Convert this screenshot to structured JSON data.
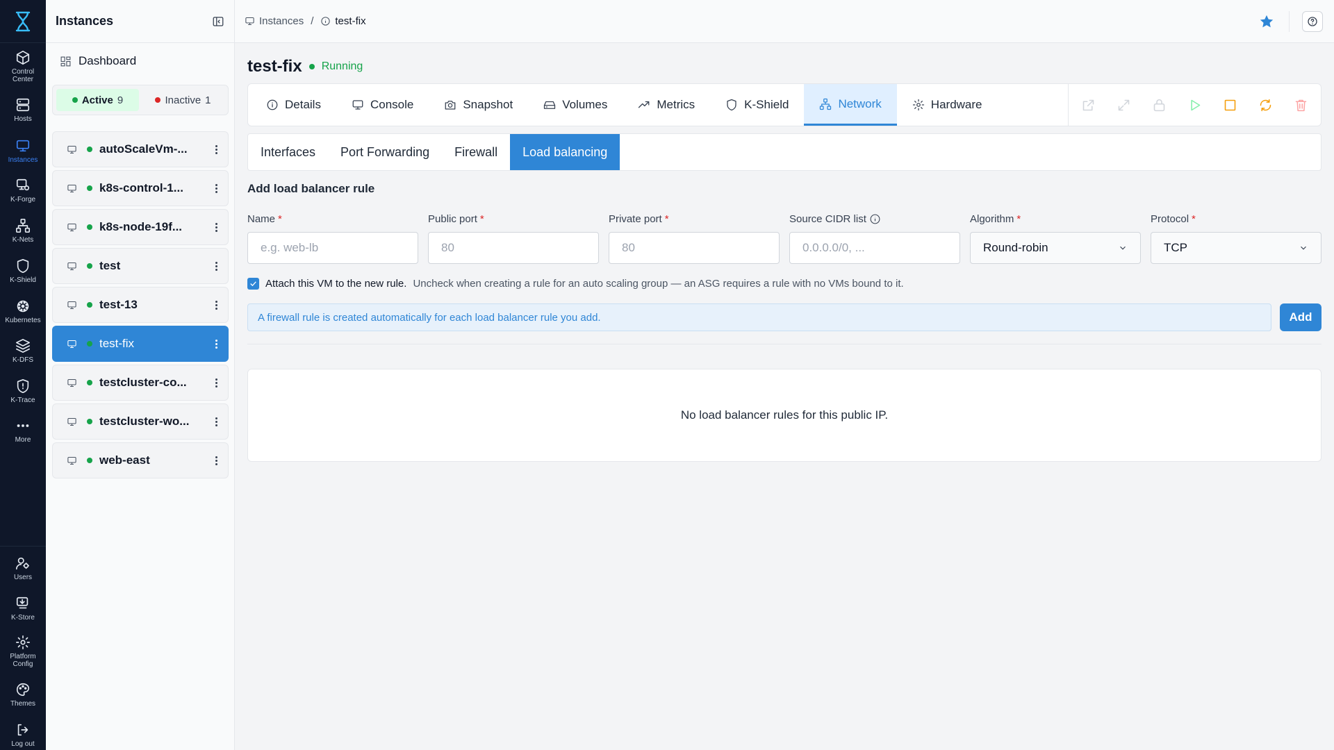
{
  "rail": {
    "items": [
      {
        "label1": "Control",
        "label2": "Center",
        "icon": "cube-icon"
      },
      {
        "label1": "Hosts",
        "label2": "",
        "icon": "server-icon"
      },
      {
        "label1": "Instances",
        "label2": "",
        "icon": "monitor-icon"
      },
      {
        "label1": "K-Forge",
        "label2": "",
        "icon": "forge-icon"
      },
      {
        "label1": "K-Nets",
        "label2": "",
        "icon": "network-icon"
      },
      {
        "label1": "K-Shield",
        "label2": "",
        "icon": "shield-icon"
      },
      {
        "label1": "Kubernetes",
        "label2": "",
        "icon": "helm-icon"
      },
      {
        "label1": "K-DFS",
        "label2": "",
        "icon": "layers-icon"
      },
      {
        "label1": "K-Trace",
        "label2": "",
        "icon": "trace-icon"
      },
      {
        "label1": "More",
        "label2": "",
        "icon": "more-icon"
      },
      {
        "label1": "Users",
        "label2": "",
        "icon": "users-icon"
      },
      {
        "label1": "K-Store",
        "label2": "",
        "icon": "store-icon"
      },
      {
        "label1": "Platform",
        "label2": "Config",
        "icon": "gear-icon"
      },
      {
        "label1": "Themes",
        "label2": "",
        "icon": "palette-icon"
      },
      {
        "label1": "Log out",
        "label2": "",
        "icon": "logout-icon"
      }
    ],
    "active_color": "#3b82f6"
  },
  "sidebar": {
    "title": "Instances",
    "dashboard": "Dashboard",
    "filter": {
      "active_label": "Active",
      "active_count": "9",
      "inactive_label": "Inactive",
      "inactive_count": "1"
    },
    "vms": [
      {
        "name": "autoScaleVm-..."
      },
      {
        "name": "k8s-control-1..."
      },
      {
        "name": "k8s-node-19f..."
      },
      {
        "name": "test"
      },
      {
        "name": "test-13"
      },
      {
        "name": "test-fix"
      },
      {
        "name": "testcluster-co..."
      },
      {
        "name": "testcluster-wo..."
      },
      {
        "name": "web-east"
      }
    ]
  },
  "topbar": {
    "crumb_root": "Instances",
    "crumb_sep": "/",
    "crumb_current": "test-fix"
  },
  "main": {
    "title": "test-fix",
    "status": "Running",
    "status_color": "#16a34a",
    "tabs": [
      {
        "label": "Details",
        "icon": "info-icon"
      },
      {
        "label": "Console",
        "icon": "monitor-icon"
      },
      {
        "label": "Snapshot",
        "icon": "camera-icon"
      },
      {
        "label": "Volumes",
        "icon": "disk-icon"
      },
      {
        "label": "Metrics",
        "icon": "trend-icon"
      },
      {
        "label": "K-Shield",
        "icon": "shield-icon"
      },
      {
        "label": "Network",
        "icon": "network-icon"
      },
      {
        "label": "Hardware",
        "icon": "gear-icon"
      }
    ],
    "subtabs": [
      "Interfaces",
      "Port Forwarding",
      "Firewall",
      "Load balancing"
    ],
    "section_title": "Add load balancer rule",
    "form": {
      "name_label": "Name",
      "name_placeholder": "e.g. web-lb",
      "public_label": "Public port",
      "public_placeholder": "80",
      "private_label": "Private port",
      "private_placeholder": "80",
      "cidr_label": "Source CIDR list",
      "cidr_placeholder": "0.0.0.0/0, ...",
      "algo_label": "Algorithm",
      "algo_value": "Round-robin",
      "proto_label": "Protocol",
      "proto_value": "TCP",
      "required_mark": "*"
    },
    "attach_strong": "Attach this VM to the new rule.",
    "attach_note": "Uncheck when creating a rule for an auto scaling group — an ASG requires a rule with no VMs bound to it.",
    "notice": "A firewall rule is created automatically for each load balancer rule you add.",
    "add_label": "Add",
    "empty_text": "No load balancer rules for this public IP.",
    "accent": "#2f86d6"
  }
}
